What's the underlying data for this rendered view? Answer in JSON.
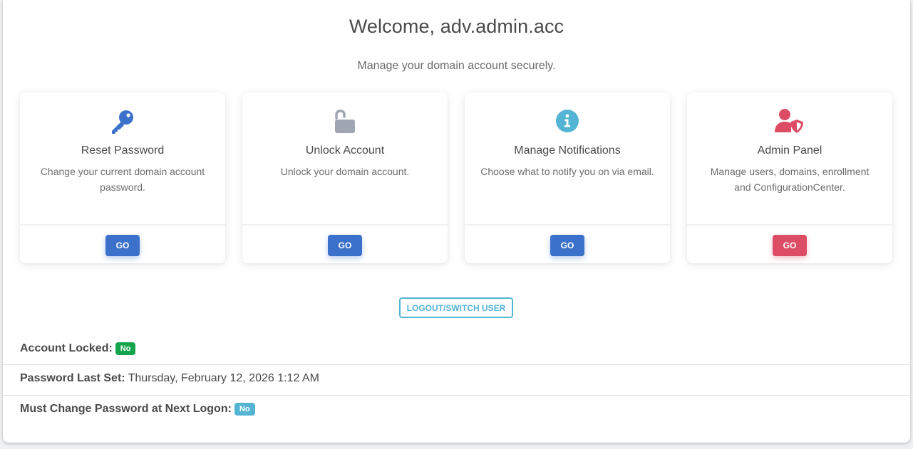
{
  "header": {
    "welcome": "Welcome, adv.admin.acc",
    "subtitle": "Manage your domain account securely."
  },
  "cards": [
    {
      "icon": "key-icon",
      "title": "Reset Password",
      "description": "Change your current domain account password.",
      "button": "GO",
      "color": "#3b71ca"
    },
    {
      "icon": "unlock-icon",
      "title": "Unlock Account",
      "description": "Unlock your domain account.",
      "button": "GO",
      "color": "#3b71ca"
    },
    {
      "icon": "info-icon",
      "title": "Manage Notifications",
      "description": "Choose what to notify you on via email.",
      "button": "GO",
      "color": "#3b71ca"
    },
    {
      "icon": "user-shield-icon",
      "title": "Admin Panel",
      "description": "Manage users, domains, enrollment and ConfigurationCenter.",
      "button": "GO",
      "color": "#dc4c64"
    }
  ],
  "logout": {
    "label": "LOGOUT/SWITCH USER"
  },
  "account": {
    "locked_label": "Account Locked:",
    "locked_value": "No",
    "password_last_set_label": "Password Last Set:",
    "password_last_set_value": "Thursday, February 12, 2026 1:12 AM",
    "must_change_label": "Must Change Password at Next Logon:",
    "must_change_value": "No"
  },
  "colors": {
    "primary": "#3b71ca",
    "danger": "#dc4c64",
    "info": "#54b4d3",
    "success": "#14a44d",
    "muted_icon": "#9fa6b2"
  }
}
